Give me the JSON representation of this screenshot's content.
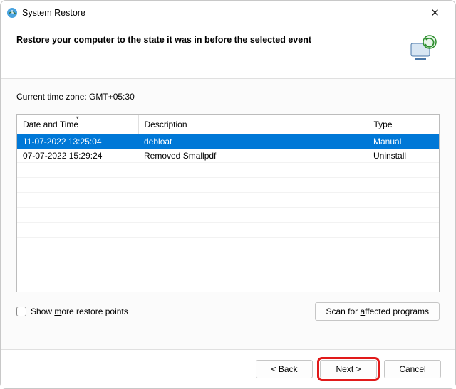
{
  "window": {
    "title": "System Restore",
    "close_glyph": "✕"
  },
  "header": {
    "instruction": "Restore your computer to the state it was in before the selected event"
  },
  "timezone_label": "Current time zone: GMT+05:30",
  "table": {
    "columns": {
      "datetime": "Date and Time",
      "description": "Description",
      "type": "Type"
    },
    "rows": [
      {
        "datetime": "11-07-2022 13:25:04",
        "description": "debloat",
        "type": "Manual",
        "selected": true
      },
      {
        "datetime": "07-07-2022 15:29:24",
        "description": "Removed Smallpdf",
        "type": "Uninstall",
        "selected": false
      }
    ]
  },
  "options": {
    "show_more_pre": "Show ",
    "show_more_u": "m",
    "show_more_post": "ore restore points",
    "scan_pre": "Scan for ",
    "scan_u": "a",
    "scan_post": "ffected programs"
  },
  "footer": {
    "back_pre": "< ",
    "back_u": "B",
    "back_post": "ack",
    "next_u": "N",
    "next_post": "ext >",
    "cancel": "Cancel"
  }
}
